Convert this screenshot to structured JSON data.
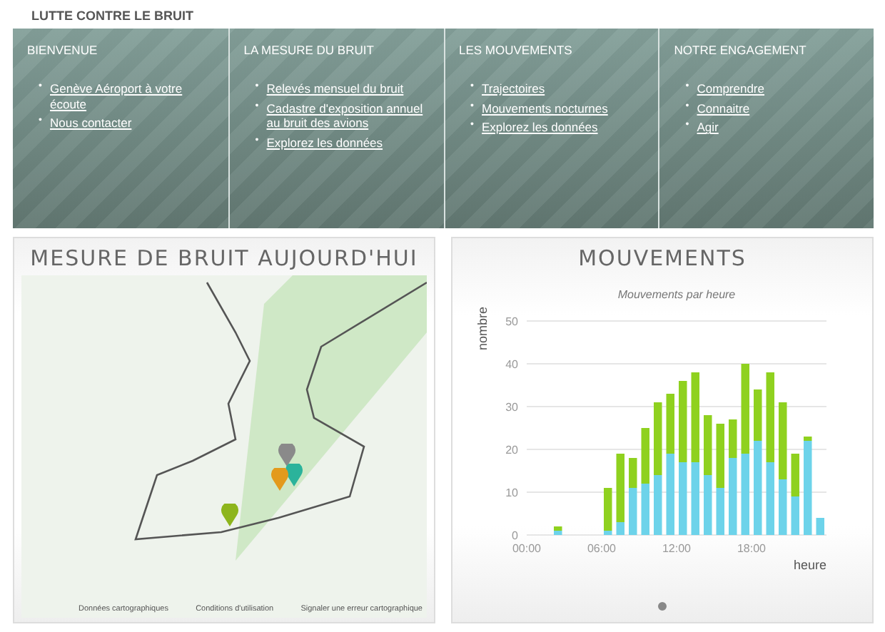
{
  "section_title": "LUTTE CONTRE LE BRUIT",
  "nav_columns": [
    {
      "heading": "BIENVENUE",
      "links": [
        {
          "bullet": "•",
          "label": "Genève Aéroport à votre écoute"
        },
        {
          "bullet": "•",
          "label": "Nous contacter"
        }
      ]
    },
    {
      "heading": "LA MESURE DU BRUIT",
      "links": [
        {
          "bullet": "•",
          "label": "Relevés mensuel du bruit"
        },
        {
          "bullet": "•",
          "label": "Cadastre d'exposition annuel au bruit des avions"
        },
        {
          "bullet": "•",
          "label": "Explorez les données"
        }
      ]
    },
    {
      "heading": "LES MOUVEMENTS",
      "links": [
        {
          "bullet": "•",
          "label": "Trajectoires"
        },
        {
          "bullet": "•",
          "label": "Mouvements nocturnes"
        },
        {
          "bullet": "•",
          "label": "Explorez les données"
        }
      ]
    },
    {
      "heading": "NOTRE ENGAGEMENT",
      "links": [
        {
          "bullet": "•",
          "label": "Comprendre"
        },
        {
          "bullet": "•",
          "label": "Connaitre"
        },
        {
          "bullet": "•",
          "label": "Agir"
        }
      ]
    }
  ],
  "noise_card": {
    "title": "MESURE DE BRUIT AUJOURD'HUI",
    "map_footer_links": [
      "Données cartographiques",
      "Conditions d'utilisation",
      "Signaler une erreur cartographique"
    ],
    "markers": [
      {
        "color": "#8a8a8a"
      },
      {
        "color": "#2bb39b"
      },
      {
        "color": "#e39a1c"
      },
      {
        "color": "#8db51c"
      }
    ]
  },
  "movements_card": {
    "title": "MOUVEMENTS",
    "chart_data": {
      "type": "bar",
      "title": "Mouvements par heure",
      "xlabel": "heure",
      "ylabel": "nombre",
      "stacked": true,
      "x": [
        0.5,
        1.5,
        2.5,
        3.5,
        4.5,
        5.5,
        6.5,
        7.5,
        8.5,
        9.5,
        10.5,
        11.5,
        12.5,
        13.5,
        14.5,
        15.5,
        16.5,
        17.5,
        18.5,
        19.5,
        20.5,
        21.5,
        22.5,
        23.5
      ],
      "grid": true,
      "xlim": [
        0,
        24
      ],
      "series": [
        {
          "color": "#6dd3ea",
          "values": [
            0,
            0,
            1,
            0,
            0,
            0,
            1,
            3,
            11,
            12,
            14,
            19,
            17,
            17,
            14,
            11,
            18,
            19,
            22,
            17,
            13,
            9,
            22,
            4
          ]
        },
        {
          "color": "#8fd11f",
          "values": [
            0,
            0,
            1,
            0,
            0,
            0,
            10,
            16,
            7,
            13,
            17,
            14,
            19,
            21,
            14,
            15,
            9,
            21,
            12,
            21,
            18,
            10,
            1,
            0
          ]
        }
      ],
      "ylim": [
        0,
        50
      ],
      "yticks": [
        0,
        10,
        20,
        30,
        40,
        50
      ],
      "xticks": [
        {
          "value": 0,
          "label": "00:00"
        },
        {
          "value": 6,
          "label": "06:00"
        },
        {
          "value": 12,
          "label": "12:00"
        },
        {
          "value": 18,
          "label": "18:00"
        }
      ]
    },
    "pager_dots": [
      {
        "selected": true
      }
    ]
  }
}
